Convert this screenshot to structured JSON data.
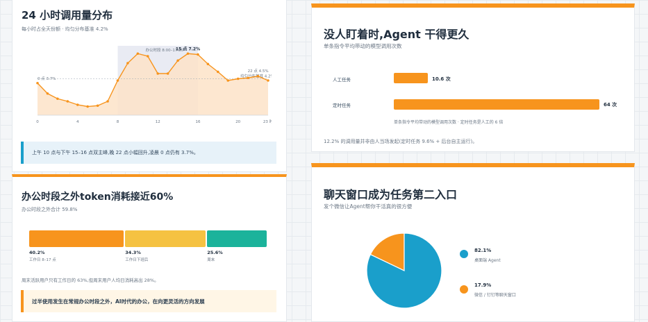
{
  "colors": {
    "accent": "#f7941d",
    "blue": "#1a9fcb",
    "yellow": "#f5c242",
    "teal": "#1bb39b",
    "area": "#fde3c8",
    "highlight": "#e9ebf3"
  },
  "card1": {
    "title": "24 小时调用量分布",
    "subtitle": "每小时占全天份额 · 均匀分布基准 4.2%",
    "note": "上午 10 点与下午 15–16 点双主峰,晚 22 点小幅回升,凌晨 0 点仍有 3.7%。"
  },
  "card2": {
    "title": "办公时段之外token消耗接近60%",
    "subtitle": "办公时段之外合计 59.8%",
    "segments": [
      {
        "value": "40.2%",
        "label": "工作日 8–17 点",
        "share": 40.2,
        "color": "#f7941d"
      },
      {
        "value": "34.3%",
        "label": "工作日下班后",
        "share": 34.3,
        "color": "#f5c242"
      },
      {
        "value": "25.6%",
        "label": "周末",
        "share": 25.6,
        "color": "#1bb39b"
      }
    ],
    "description": "周末活跃用户只有工作日的 63%,但周末用户人均日消耗高出 28%。",
    "note": "过半使用发生在常规办公时段之外，AI时代的办公，在向更灵活的方向发展"
  },
  "card3": {
    "title": "没人盯着时,Agent 干得更久",
    "subtitle": "单条指令平均带动的模型调用次数",
    "bars": [
      {
        "label": "人工任务",
        "value": 10.6,
        "value_text": "10.6 次"
      },
      {
        "label": "定时任务",
        "value": 64,
        "value_text": "64 次"
      }
    ],
    "bar_note": "单条指令平均带动的模型调用次数 · 定时任务是人工的 6 倍",
    "description": "12.2% 的调用量并非由人当场发起(定时任务 9.6% + 后台自主运行)。"
  },
  "card4": {
    "title": "聊天窗口成为任务第二入口",
    "subtitle": "发个微信让Agent帮你干活真的很方便",
    "legend": [
      {
        "value": "82.1%",
        "label": "桌面端 Agent",
        "color": "#1a9fcb"
      },
      {
        "value": "17.9%",
        "label": "微信 / 钉钉等聊天窗口",
        "color": "#f7941d"
      }
    ]
  },
  "chart_data": [
    {
      "type": "area",
      "title": "24 小时调用量分布",
      "x": [
        0,
        1,
        2,
        3,
        4,
        5,
        6,
        7,
        8,
        9,
        10,
        11,
        12,
        13,
        14,
        15,
        16,
        17,
        18,
        19,
        20,
        21,
        22,
        23
      ],
      "y": [
        3.7,
        2.5,
        1.9,
        1.6,
        1.2,
        1.0,
        1.1,
        1.6,
        4.0,
        6.0,
        7.1,
        6.8,
        4.8,
        4.8,
        6.3,
        7.1,
        7.0,
        5.9,
        5.0,
        4.0,
        4.2,
        4.3,
        4.5,
        4.0
      ],
      "xticks": [
        "0",
        "4",
        "8",
        "12",
        "16",
        "20",
        "23 时"
      ],
      "ylim": [
        0,
        8
      ],
      "baseline": 4.2,
      "baseline_label": "均匀分布基准 4.2%",
      "highlight_range": [
        8,
        16
      ],
      "highlight_label": "办公时段 8:00–17:00",
      "annotations": [
        {
          "x": 0,
          "text": "0 点 3.7%"
        },
        {
          "x": 15,
          "text": "15 点 7.2%"
        },
        {
          "x": 22,
          "text": "22 点 4.5%"
        }
      ]
    },
    {
      "type": "bar",
      "title": "办公时段之外合计 59.8%",
      "categories": [
        "工作日 8–17 点",
        "工作日下班后",
        "周末"
      ],
      "values": [
        40.2,
        34.3,
        25.6
      ]
    },
    {
      "type": "bar",
      "title": "单条指令平均带动的模型调用次数",
      "categories": [
        "人工任务",
        "定时任务"
      ],
      "values": [
        10.6,
        64
      ]
    },
    {
      "type": "pie",
      "categories": [
        "桌面端 Agent",
        "微信 / 钉钉等聊天窗口"
      ],
      "values": [
        82.1,
        17.9
      ]
    }
  ]
}
